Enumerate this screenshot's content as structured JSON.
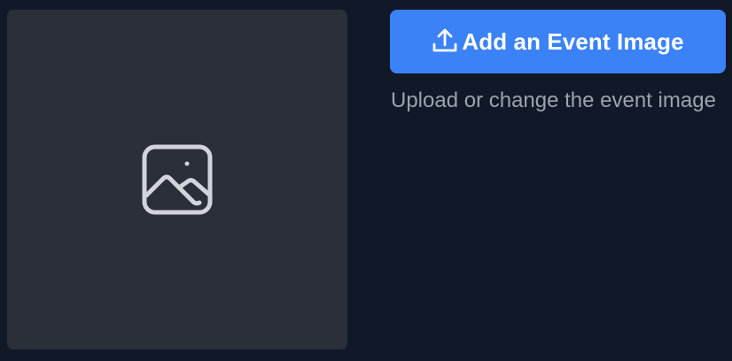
{
  "image_placeholder": {
    "icon": "image-icon"
  },
  "upload": {
    "label": "Add an Event Image",
    "icon": "upload-icon",
    "color": "#3b82f6",
    "helper_text": "Upload or change the event image"
  },
  "colors": {
    "background": "#111827",
    "placeholder_bg": "#2a2f3a",
    "icon_stroke": "#d1d5db",
    "helper_text": "#9ca3af"
  }
}
